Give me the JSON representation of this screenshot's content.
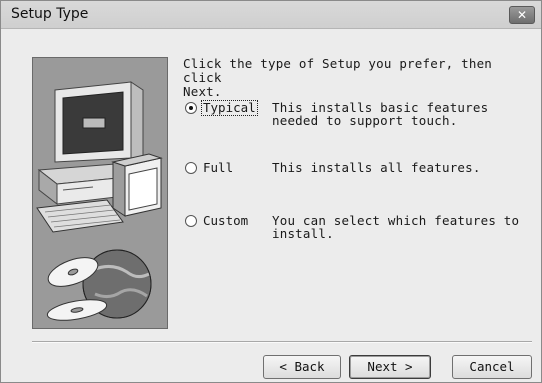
{
  "window": {
    "title": "Setup Type",
    "close_icon": "close-icon"
  },
  "intro": "Click the type of Setup you prefer, then click\nNext.",
  "options": [
    {
      "label": "Typical",
      "checked": true,
      "description": "This installs basic features needed to support touch."
    },
    {
      "label": "Full",
      "checked": false,
      "description": "This installs all features."
    },
    {
      "label": "Custom",
      "checked": false,
      "description": "You can select which features to install."
    }
  ],
  "buttons": {
    "back": "< Back",
    "next": "Next >",
    "cancel": "Cancel"
  },
  "art": {
    "icon": "computer-disc-globe-illustration"
  }
}
